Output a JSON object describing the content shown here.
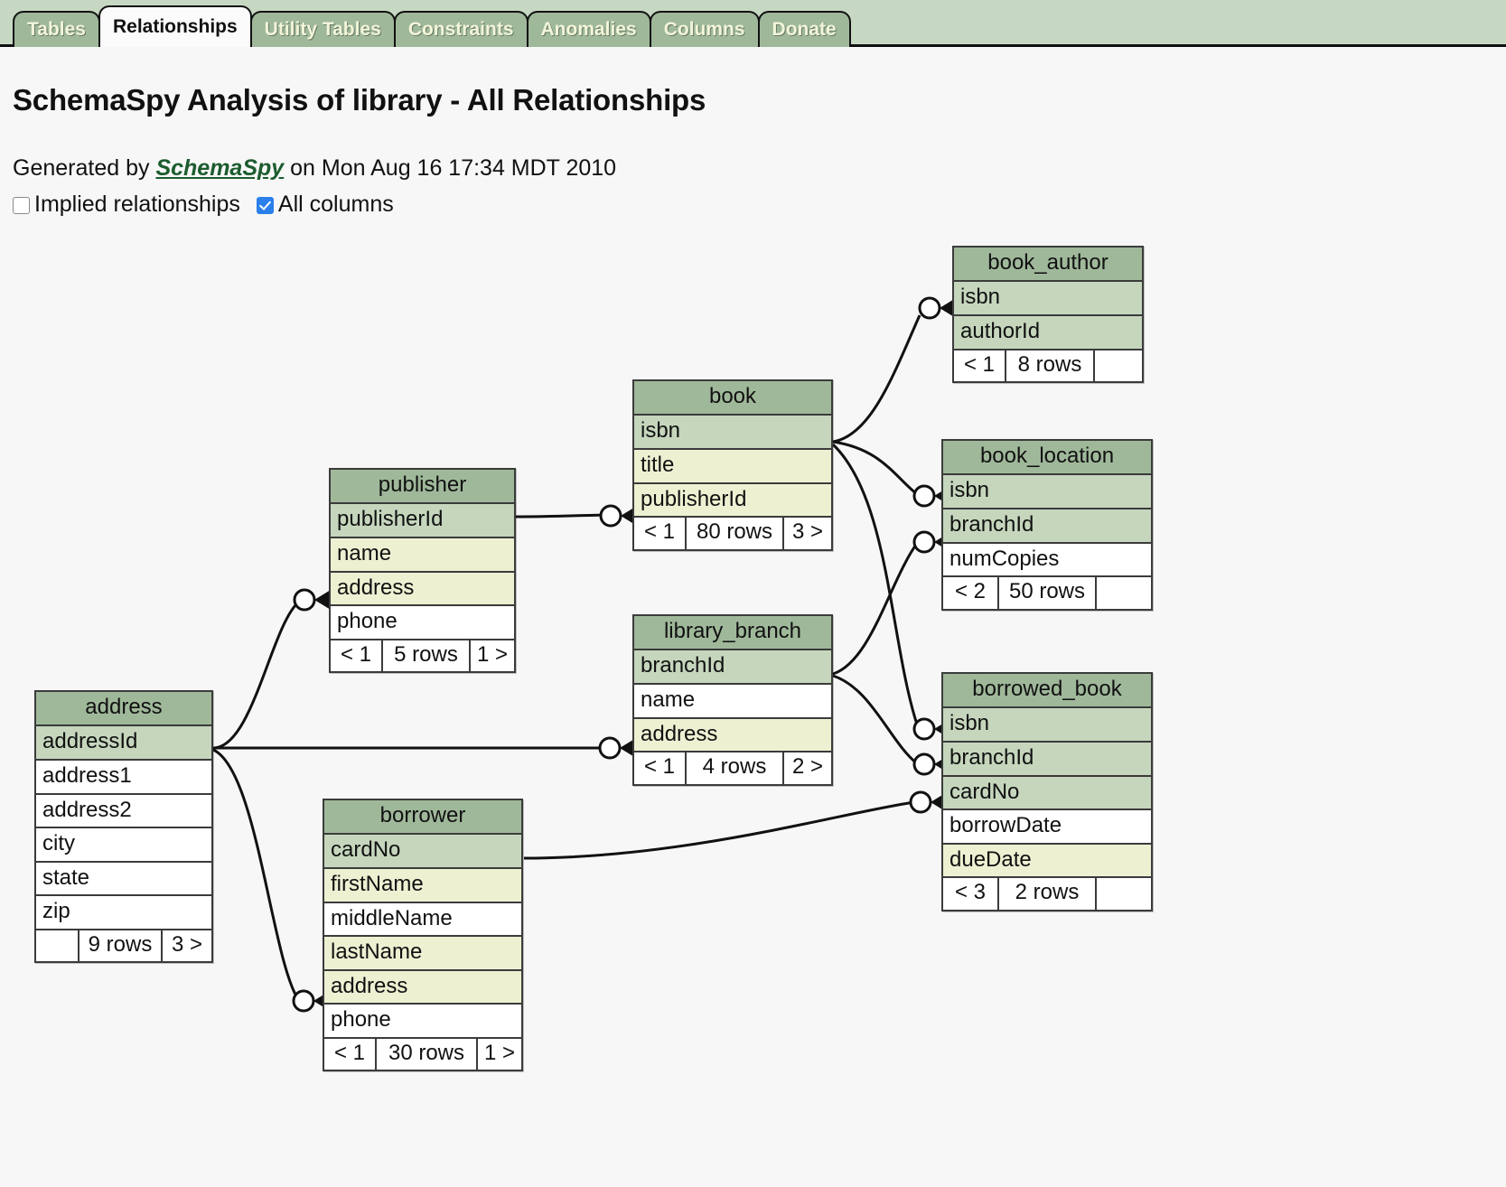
{
  "tabs": [
    {
      "label": "Tables",
      "active": false
    },
    {
      "label": "Relationships",
      "active": true
    },
    {
      "label": "Utility Tables",
      "active": false
    },
    {
      "label": "Constraints",
      "active": false
    },
    {
      "label": "Anomalies",
      "active": false
    },
    {
      "label": "Columns",
      "active": false
    },
    {
      "label": "Donate",
      "active": false
    }
  ],
  "header": {
    "title": "SchemaSpy Analysis of library - All Relationships",
    "generated_prefix": "Generated by",
    "generator_name": "SchemaSpy",
    "generated_suffix": "on Mon Aug 16 17:34 MDT 2010",
    "options": [
      {
        "label": "Implied relationships",
        "checked": false
      },
      {
        "label": "All columns",
        "checked": true
      }
    ]
  },
  "colors": {
    "page_background": "#f7f7f7",
    "tab_bar": "#c7d8c2",
    "tab_inactive": "#9fb89a",
    "tab_inactive_text": "#f2f5d8",
    "tab_active": "#fbfbfb",
    "tab_active_text": "#111111",
    "entity_header": "#9fb89a",
    "column_primary_key": "#c5d6bd",
    "column_indexed": "#eef0d2",
    "column_plain": "#ffffff",
    "border": "#3b3b3b",
    "link": "#1c5c2e"
  },
  "diagram": {
    "title": "All Relationships",
    "entities": [
      {
        "name": "book_author",
        "columns": [
          {
            "name": "isbn",
            "kind": "primary_key"
          },
          {
            "name": "authorId",
            "kind": "primary_key"
          }
        ],
        "footer": [
          "< 1",
          "8 rows",
          ""
        ]
      },
      {
        "name": "book",
        "columns": [
          {
            "name": "isbn",
            "kind": "primary_key"
          },
          {
            "name": "title",
            "kind": "indexed"
          },
          {
            "name": "publisherId",
            "kind": "indexed"
          }
        ],
        "footer": [
          "< 1",
          "80 rows",
          "3 >"
        ]
      },
      {
        "name": "book_location",
        "columns": [
          {
            "name": "isbn",
            "kind": "primary_key"
          },
          {
            "name": "branchId",
            "kind": "primary_key"
          },
          {
            "name": "numCopies",
            "kind": "plain"
          }
        ],
        "footer": [
          "< 2",
          "50 rows",
          ""
        ]
      },
      {
        "name": "publisher",
        "columns": [
          {
            "name": "publisherId",
            "kind": "primary_key"
          },
          {
            "name": "name",
            "kind": "indexed"
          },
          {
            "name": "address",
            "kind": "indexed"
          },
          {
            "name": "phone",
            "kind": "plain"
          }
        ],
        "footer": [
          "< 1",
          "5 rows",
          "1 >"
        ]
      },
      {
        "name": "library_branch",
        "columns": [
          {
            "name": "branchId",
            "kind": "primary_key"
          },
          {
            "name": "name",
            "kind": "plain"
          },
          {
            "name": "address",
            "kind": "indexed"
          }
        ],
        "footer": [
          "< 1",
          "4 rows",
          "2 >"
        ]
      },
      {
        "name": "borrowed_book",
        "columns": [
          {
            "name": "isbn",
            "kind": "primary_key"
          },
          {
            "name": "branchId",
            "kind": "primary_key"
          },
          {
            "name": "cardNo",
            "kind": "primary_key"
          },
          {
            "name": "borrowDate",
            "kind": "plain"
          },
          {
            "name": "dueDate",
            "kind": "indexed"
          }
        ],
        "footer": [
          "< 3",
          "2 rows",
          ""
        ]
      },
      {
        "name": "address",
        "columns": [
          {
            "name": "addressId",
            "kind": "primary_key"
          },
          {
            "name": "address1",
            "kind": "plain"
          },
          {
            "name": "address2",
            "kind": "plain"
          },
          {
            "name": "city",
            "kind": "plain"
          },
          {
            "name": "state",
            "kind": "plain"
          },
          {
            "name": "zip",
            "kind": "plain"
          }
        ],
        "footer": [
          "",
          "9 rows",
          "3 >"
        ]
      },
      {
        "name": "borrower",
        "columns": [
          {
            "name": "cardNo",
            "kind": "primary_key"
          },
          {
            "name": "firstName",
            "kind": "indexed"
          },
          {
            "name": "middleName",
            "kind": "plain"
          },
          {
            "name": "lastName",
            "kind": "indexed"
          },
          {
            "name": "address",
            "kind": "indexed"
          },
          {
            "name": "phone",
            "kind": "plain"
          }
        ],
        "footer": [
          "< 1",
          "30 rows",
          "1 >"
        ]
      }
    ],
    "relationships": [
      {
        "from": "book.isbn",
        "to": "book_author.isbn"
      },
      {
        "from": "book.isbn",
        "to": "book_location.isbn"
      },
      {
        "from": "book.isbn",
        "to": "borrowed_book.isbn"
      },
      {
        "from": "publisher.publisherId",
        "to": "book.publisherId"
      },
      {
        "from": "address.addressId",
        "to": "publisher.address"
      },
      {
        "from": "address.addressId",
        "to": "library_branch.address"
      },
      {
        "from": "address.addressId",
        "to": "borrower.address"
      },
      {
        "from": "library_branch.branchId",
        "to": "book_location.branchId"
      },
      {
        "from": "library_branch.branchId",
        "to": "borrowed_book.branchId"
      },
      {
        "from": "borrower.cardNo",
        "to": "borrowed_book.cardNo"
      }
    ]
  }
}
